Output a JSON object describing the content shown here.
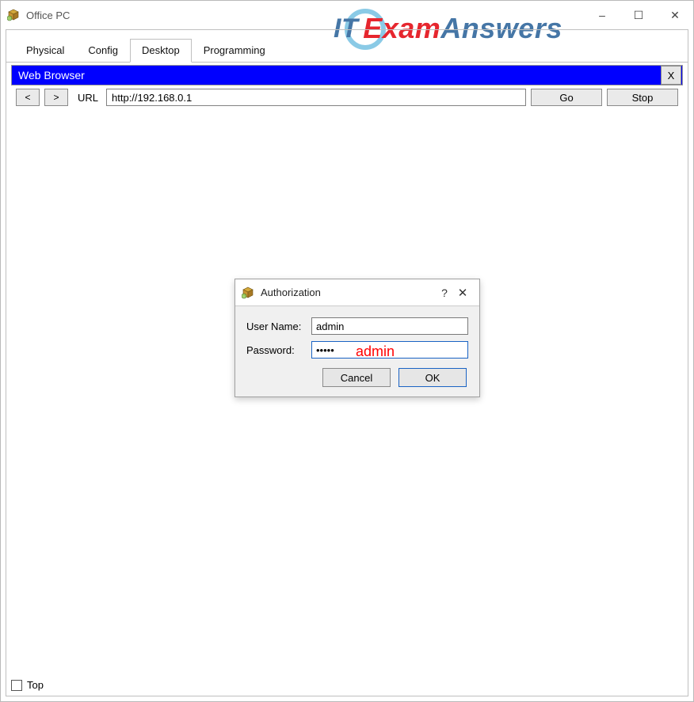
{
  "window": {
    "title": "Office PC",
    "minimize": "–",
    "maximize": "☐",
    "close": "✕"
  },
  "watermark": {
    "it": "IT",
    "exam": "Exam",
    "answers": "Answers"
  },
  "tabs": {
    "physical": "Physical",
    "config": "Config",
    "desktop": "Desktop",
    "programming": "Programming"
  },
  "webBrowser": {
    "title": "Web Browser",
    "close_x": "X",
    "back": "<",
    "forward": ">",
    "url_label": "URL",
    "url_value": "http://192.168.0.1",
    "go": "Go",
    "stop": "Stop"
  },
  "auth": {
    "title": "Authorization",
    "help": "?",
    "close": "✕",
    "username_label": "User Name:",
    "username_value": "admin",
    "password_label": "Password:",
    "password_value": "•••••",
    "hint_overlay": "admin",
    "cancel": "Cancel",
    "ok": "OK"
  },
  "footer": {
    "top_label": "Top",
    "top_checked": false
  }
}
